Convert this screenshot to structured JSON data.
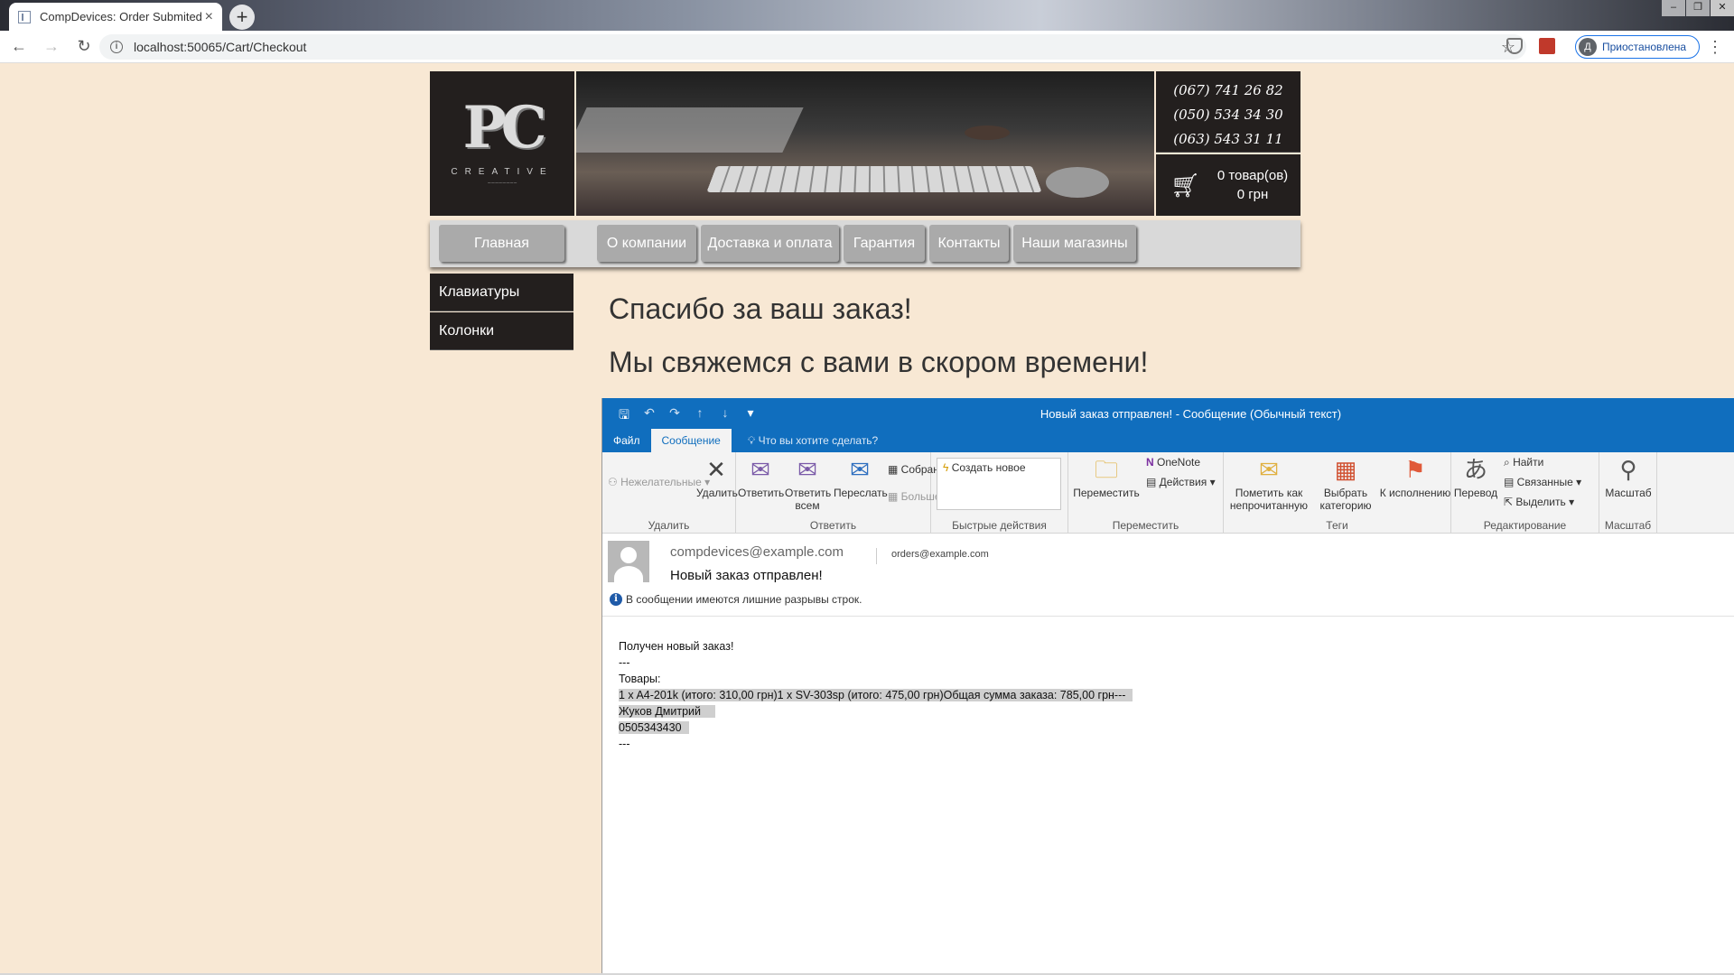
{
  "browser": {
    "tab_title": "CompDevices: Order Submited",
    "tab_close": "×",
    "new_tab": "+",
    "url": "localhost:50065/Cart/Checkout",
    "profile_initial": "Д",
    "profile_label": "Приостановлена"
  },
  "site": {
    "logo_text": "PC",
    "logo_sub": "CREATIVE",
    "phones": [
      "(067) 741 26 82",
      "(050) 534 34 30",
      "(063) 543 31 11"
    ],
    "cart_items": "0 товар(ов)",
    "cart_total": "0 грн",
    "nav": [
      "Главная",
      "О компании",
      "Доставка и оплата",
      "Гарантия",
      "Контакты",
      "Наши магазины"
    ],
    "sidebar": [
      "Клавиатуры",
      "Колонки"
    ],
    "thanks": "Спасибо за ваш заказ!",
    "contact_soon": "Мы свяжемся с вами в скором времени!"
  },
  "outlook": {
    "caption": "Новый заказ отправлен!  -  Сообщение (Обычный текст)",
    "tabs": {
      "file": "Файл",
      "message": "Сообщение",
      "tell_me": "Что вы хотите сделать?"
    },
    "ribbon": {
      "junk": "Нежелательные",
      "delete": "Удалить",
      "group_delete": "Удалить",
      "reply": "Ответить",
      "reply_all": "Ответить всем",
      "forward": "Переслать",
      "meeting": "Собрание",
      "more": "Больше",
      "group_respond": "Ответить",
      "quick_new": "Создать новое",
      "group_quick": "Быстрые действия",
      "move": "Переместить",
      "onenote": "OneNote",
      "actions": "Действия",
      "group_move": "Переместить",
      "mark_unread": "Пометить как непрочитанную",
      "categorize": "Выбрать категорию",
      "followup": "К исполнению",
      "group_tags": "Теги",
      "translate": "Перевод",
      "find": "Найти",
      "related": "Связанные",
      "select": "Выделить",
      "group_editing": "Редактирование",
      "zoom": "Масштаб",
      "group_zoom": "Масштаб"
    },
    "from": "compdevices@example.com",
    "to": "orders@example.com",
    "subject": "Новый заказ отправлен!",
    "notice": "В сообщении имеются лишние разрывы строк.",
    "body": {
      "line1": "Получен новый заказ!",
      "line2": "---",
      "line3": "Товары:",
      "line4": "1 x A4-201k (итого: 310,00 грн)1 x SV-303sp (итого: 475,00 грн)Общая сумма заказа: 785,00 грн---",
      "line5": "Жуков Дмитрий",
      "line6": "0505343430",
      "line7": "---"
    }
  }
}
